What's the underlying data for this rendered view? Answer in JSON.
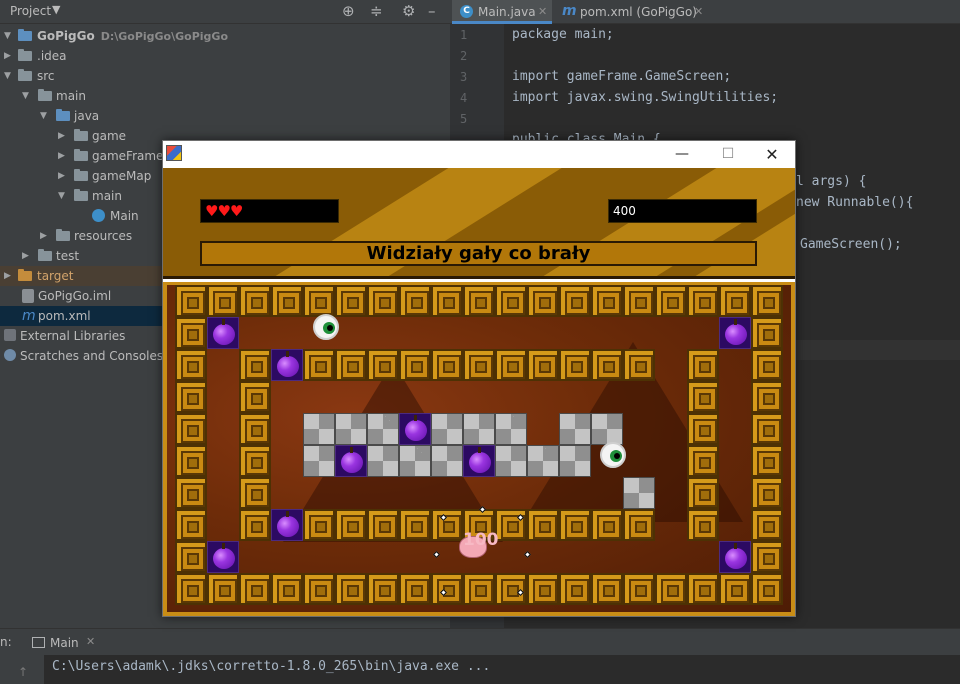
{
  "project_panel": {
    "title": "Project",
    "tree": [
      {
        "label": "GoPigGo",
        "path": "D:\\GoPigGo\\GoPigGo",
        "type": "module"
      },
      {
        "label": ".idea",
        "type": "folder"
      },
      {
        "label": "src",
        "type": "folder"
      },
      {
        "label": "main",
        "type": "folder"
      },
      {
        "label": "java",
        "type": "folder"
      },
      {
        "label": "game",
        "type": "folder"
      },
      {
        "label": "gameFrame",
        "type": "folder"
      },
      {
        "label": "gameMap",
        "type": "folder"
      },
      {
        "label": "main",
        "type": "folder"
      },
      {
        "label": "Main",
        "type": "class"
      },
      {
        "label": "resources",
        "type": "folder"
      },
      {
        "label": "test",
        "type": "folder"
      },
      {
        "label": "target",
        "type": "folder"
      },
      {
        "label": "GoPigGo.iml",
        "type": "file"
      },
      {
        "label": "pom.xml",
        "type": "file"
      },
      {
        "label": "External Libraries",
        "type": "library"
      },
      {
        "label": "Scratches and Consoles",
        "type": "scratch"
      }
    ]
  },
  "editor": {
    "tabs": [
      {
        "label": "Main.java",
        "icon": "class-icon",
        "active": true
      },
      {
        "label": "pom.xml (GoPigGo)",
        "icon": "maven-icon",
        "active": false
      }
    ],
    "line_numbers": [
      "1",
      "2",
      "3",
      "4",
      "5"
    ],
    "code": {
      "l1": "package main;",
      "l3": "import gameFrame.GameScreen;",
      "l4": "import javax.swing.SwingUtilities;",
      "l6": "public class Main {",
      "l8_tail": "l args) {",
      "l9_tail": "new Runnable(){",
      "l11_tail": "GameScreen();"
    }
  },
  "run_panel": {
    "label": "n:",
    "tab": "Main",
    "console": "C:\\Users\\adamk\\.jdks\\corretto-1.8.0_265\\bin\\java.exe ..."
  },
  "game": {
    "hearts": "♥♥♥",
    "lives": 3,
    "score": "400",
    "level_title": "Widziały gały co brały",
    "floating_points": "100"
  },
  "colors": {
    "ide_bg": "#2b2b2b",
    "panel_bg": "#3c3f41",
    "hud_bg": "#8a5c06",
    "tile": "#d59a1a",
    "apple": "#9a35e0"
  }
}
